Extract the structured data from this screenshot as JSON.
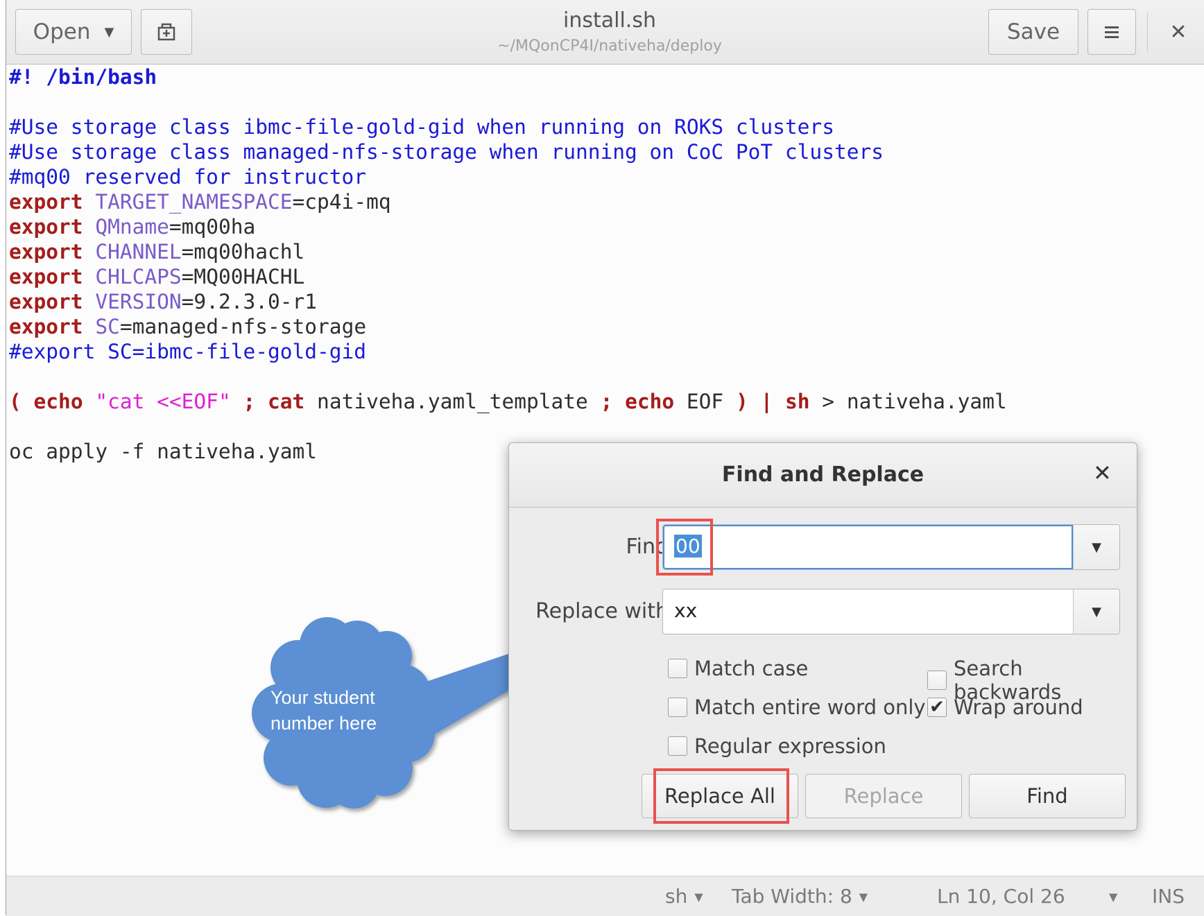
{
  "header": {
    "open_label": "Open",
    "title": "install.sh",
    "subtitle": "~/MQonCP4I/nativeha/deploy",
    "save_label": "Save"
  },
  "editor": {
    "l1": "#! /bin/bash",
    "l2": "#Use storage class ibmc-file-gold-gid when running on ROKS clusters",
    "l3": "#Use storage class managed-nfs-storage when running on CoC PoT clusters",
    "l4": "#mq00 reserved for instructor",
    "export_kw": "export",
    "exports": [
      {
        "name": "TARGET_NAMESPACE",
        "value": "=cp4i-mq"
      },
      {
        "name": "QMname",
        "value": "=mq00ha"
      },
      {
        "name": "CHANNEL",
        "value": "=mq00hachl"
      },
      {
        "name": "CHLCAPS",
        "value": "=MQ00HACHL"
      },
      {
        "name": "VERSION",
        "value": "=9.2.3.0-r1"
      },
      {
        "name": "SC",
        "value": "=managed-nfs-storage"
      }
    ],
    "l11": "#export SC=ibmc-file-gold-gid",
    "pipe": {
      "paren_open": "( ",
      "echo1": "echo",
      "str": " \"cat <<EOF\"",
      "semi1": " ;",
      "cat": " cat",
      "file": " nativeha.yaml_template ",
      "semi2": ";",
      "echo2": " echo",
      "eof": " EOF ",
      "paren_close": ")",
      "bar": " |",
      "sh": " sh",
      "redir": " > nativeha.yaml"
    },
    "l15": "oc apply -f nativeha.yaml"
  },
  "dialog": {
    "title": "Find and Replace",
    "find_label": "Find",
    "find_value": "00",
    "replace_label": "Replace with",
    "replace_value": "xx",
    "options": {
      "match_case": {
        "label": "Match case",
        "checked": false
      },
      "search_backwards": {
        "label": "Search backwards",
        "checked": false
      },
      "entire_word": {
        "label": "Match entire word only",
        "checked": false
      },
      "wrap_around": {
        "label": "Wrap around",
        "checked": true
      },
      "regex": {
        "label": "Regular expression",
        "checked": false
      }
    },
    "replace_all_label": "Replace All",
    "replace_label_btn": "Replace",
    "find_button_label": "Find"
  },
  "callout": {
    "text_line1": "Your student",
    "text_line2": "number here",
    "color": "#5b8fd3"
  },
  "statusbar": {
    "language": "sh",
    "tab_width": "Tab Width: 8",
    "position": "Ln 10, Col 26",
    "mode": "INS"
  },
  "colors": {
    "highlight": "#e8534f",
    "focus": "#4a90d9",
    "keyword": "#a61c1c",
    "comment": "#1a1ad8",
    "variable": "#7a5cc9",
    "string": "#e020d0"
  }
}
